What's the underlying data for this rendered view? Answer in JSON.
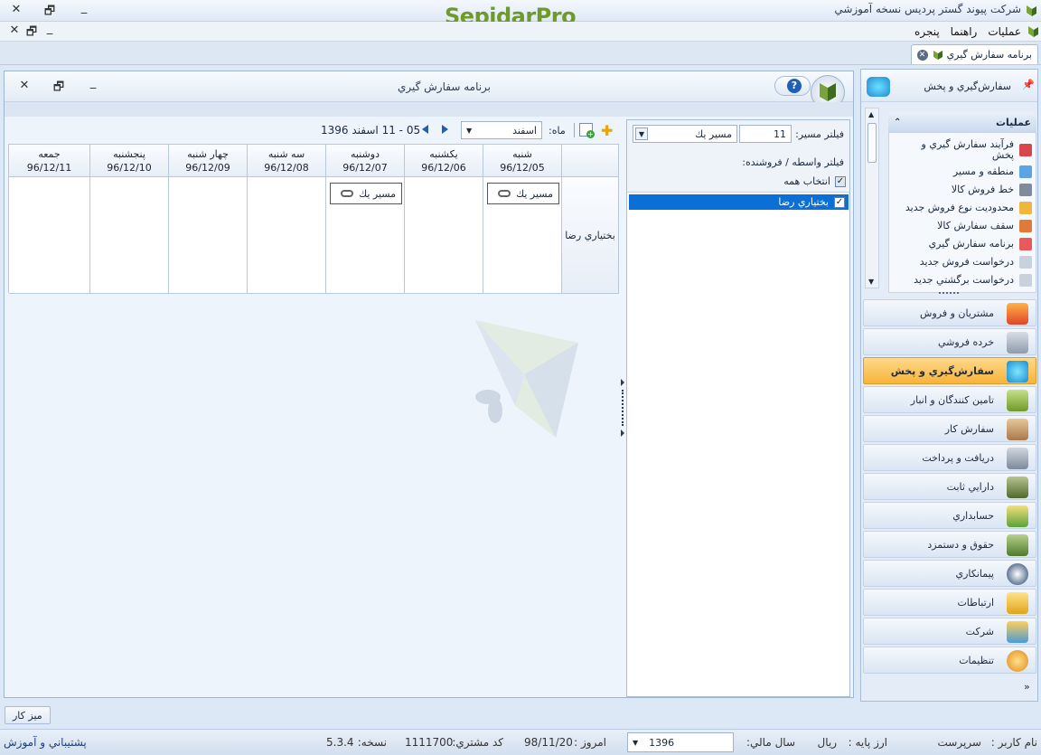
{
  "app": {
    "title": "شركت پيوند گستر پرديس نسخه آموزشي",
    "logo_text": "SepidarPro"
  },
  "menubar": {
    "items": [
      "عمليات",
      "راهنما",
      "پنجره"
    ]
  },
  "tab": {
    "label": "برنامه سفارش گيري"
  },
  "content": {
    "window_title": "برنامه سفارش گيري",
    "filter": {
      "route_label": "فيلتر مسير:",
      "route_code": "11",
      "route_name": "مسير يك",
      "agent_label": "فيلتر واسطه / فروشنده:",
      "select_all_label": "انتخاب همه",
      "agents": [
        "بختياري رضا"
      ]
    },
    "schedule": {
      "month_label": "ماه:",
      "month_value": "اسفند",
      "range_text": "05 - 11 اسفند 1396",
      "days": [
        {
          "name": "شنبه",
          "date": "96/12/05"
        },
        {
          "name": "يكشنبه",
          "date": "96/12/06"
        },
        {
          "name": "دوشنبه",
          "date": "96/12/07"
        },
        {
          "name": "سه شنبه",
          "date": "96/12/08"
        },
        {
          "name": "چهار شنبه",
          "date": "96/12/09"
        },
        {
          "name": "پنجشنبه",
          "date": "96/12/10"
        },
        {
          "name": "جمعه",
          "date": "96/12/11"
        }
      ],
      "row_agent": "بختياري رضا",
      "route_chip_label": "مسير يك"
    }
  },
  "nav": {
    "header": "سفارش‌گيري و پخش",
    "ops_title": "عمليات",
    "operations": [
      "فرآيند سفارش گيري و پخش",
      "منطقه و مسير",
      "خط فروش كالا",
      "محدوديت نوع فروش جديد",
      "سقف سفارش كالا",
      "برنامه سفارش گيري",
      "درخواست فروش جديد",
      "درخواست برگشتي جديد"
    ],
    "modules": [
      "مشتريان و فروش",
      "خرده فروشي",
      "سفارش‌گيري و پخش",
      "تامين كنندگان و انبار",
      "سفارش كار",
      "دريافت و پرداخت",
      "دارايي ثابت",
      "حسابداري",
      "حقوق و دستمزد",
      "پيمانكاري",
      "ارتباطات",
      "شركت",
      "تنظيمات"
    ],
    "active_module": "سفارش‌گيري و پخش"
  },
  "desk": {
    "button": "ميز كار"
  },
  "status": {
    "username_label": "نام كاربر :",
    "username": "سرپرست",
    "currency_label": "ارز پايه :",
    "currency": "ريال",
    "fiscal_label": "سال مالي:",
    "fiscal_year": "1396",
    "today_label": "امروز :",
    "today": "98/11/20",
    "customer_label": "كد مشتري:",
    "customer_code": "1111700",
    "version_label": "نسخه:",
    "version": "5.3.4",
    "support": "پشتيباني و آموزش"
  },
  "colors": {
    "accent": "#0a6fd6",
    "active_module": "#f6b43b",
    "logo_green": "#6f9a2a"
  }
}
